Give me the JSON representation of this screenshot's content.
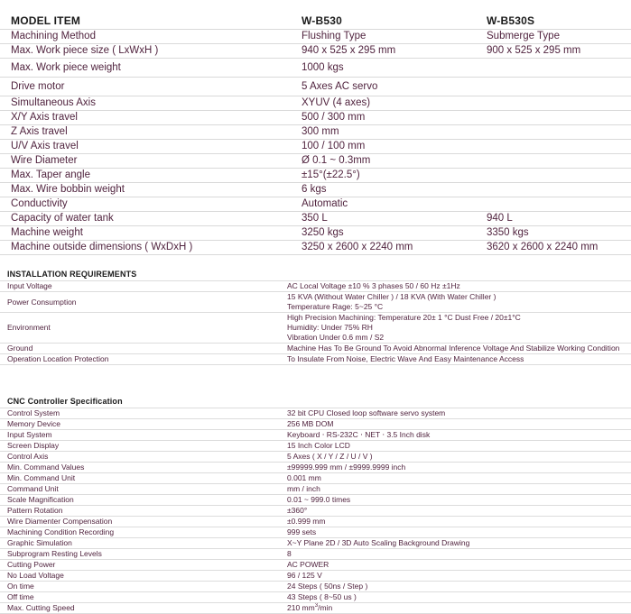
{
  "model_table": {
    "headers": [
      "MODEL ITEM",
      "W-B530",
      "W-B530S"
    ],
    "rows": [
      {
        "item": "Machining Method",
        "b530": "Flushing Type",
        "b530s": "Submerge Type"
      },
      {
        "item": "Max. Work piece size ( LxWxH )",
        "b530": "940 x 525 x 295 mm",
        "b530s": "900 x 525 x 295 mm"
      },
      {
        "item": "Max. Work piece weight",
        "b530": "1000 kgs",
        "b530s": ""
      },
      {
        "item": "Drive motor",
        "b530": "5 Axes AC servo",
        "b530s": ""
      },
      {
        "item": "Simultaneous Axis",
        "b530": "XYUV (4 axes)",
        "b530s": ""
      },
      {
        "item": "X/Y Axis travel",
        "b530": "500 / 300 mm",
        "b530s": ""
      },
      {
        "item": "Z Axis travel",
        "b530": "300 mm",
        "b530s": ""
      },
      {
        "item": "U/V Axis travel",
        "b530": "100 / 100 mm",
        "b530s": ""
      },
      {
        "item": "Wire Diameter",
        "b530": "Ø 0.1 ~ 0.3mm",
        "b530s": ""
      },
      {
        "item": "Max. Taper angle",
        "b530": "±15°(±22.5°)",
        "b530s": ""
      },
      {
        "item": "Max. Wire bobbin weight",
        "b530": "6 kgs",
        "b530s": ""
      },
      {
        "item": "Conductivity",
        "b530": "Automatic",
        "b530s": ""
      },
      {
        "item": "Capacity of water tank",
        "b530": "350 L",
        "b530s": "940 L"
      },
      {
        "item": "Machine weight",
        "b530": "3250 kgs",
        "b530s": "3350 kgs"
      },
      {
        "item": "Machine outside dimensions ( WxDxH )",
        "b530": "3250 x 2600 x 2240 mm",
        "b530s": "3620 x 2600 x 2240 mm"
      }
    ]
  },
  "installation": {
    "title": "INSTALLATION REQUIREMENTS",
    "rows": [
      {
        "label": "Input Voltage",
        "lines": [
          "AC Local Voltage ±10 % 3 phases 50 / 60 Hz ±1Hz"
        ]
      },
      {
        "label": "Power Consumption",
        "lines": [
          "15 KVA (Without Water Chiller ) / 18 KVA (With Water Chiller )",
          "Temperature Rage: 5~25 °C"
        ]
      },
      {
        "label": "Environment",
        "lines": [
          "High Precision Machining: Temperature 20± 1 °C Dust Free / 20±1°C",
          "Humidity: Under 75% RH",
          "Vibration Under 0.6 mm / S2"
        ]
      },
      {
        "label": "Ground",
        "lines": [
          "Machine Has To Be Ground To Avoid Abnormal Inference Voltage And Stabilize Working Condition"
        ]
      },
      {
        "label": "Operation Location Protection",
        "lines": [
          "To Insulate From Noise, Electric Wave And Easy Maintenance Access"
        ]
      }
    ]
  },
  "cnc": {
    "title": "CNC Controller Specification",
    "rows": [
      {
        "label": "Control System",
        "value": "32 bit CPU Closed loop software servo system"
      },
      {
        "label": "Memory Device",
        "value": "256 MB DOM"
      },
      {
        "label": "Input System",
        "value": "Keyboard ‧ RS-232C ‧ NET ‧ 3.5 Inch disk"
      },
      {
        "label": "Screen Display",
        "value": "15 Inch Color LCD"
      },
      {
        "label": "Control Axis",
        "value": "5 Axes ( X / Y / Z / U / V )"
      },
      {
        "label": "Min. Command Values",
        "value": "±99999.999 mm / ±9999.9999 inch"
      },
      {
        "label": "Min. Command Unit",
        "value": "0.001 mm"
      },
      {
        "label": "Command Unit",
        "value": "mm / inch"
      },
      {
        "label": "Scale Magnification",
        "value": "0.01 ~ 999.0 times"
      },
      {
        "label": "Pattern Rotation",
        "value": "±360°"
      },
      {
        "label": "Wire Diamenter Compensation",
        "value": "±0.999 mm"
      },
      {
        "label": "Machining Condition Recording",
        "value": "999 sets"
      },
      {
        "label": "Graphic Simulation",
        "value": "X~Y Plane 2D / 3D Auto Scaling Background Drawing"
      },
      {
        "label": "Subprogram Resting Levels",
        "value": "8"
      },
      {
        "label": "Cutting Power",
        "value": "AC POWER"
      },
      {
        "label": "No Load Voltage",
        "value": "96 / 125 V"
      },
      {
        "label": "On time",
        "value": "24 Steps ( 50ns / Step )"
      },
      {
        "label": "Off time",
        "value": "43 Steps ( 8~50 us )"
      },
      {
        "label": "Max. Cutting Speed",
        "value": "210 mm<sup>3</sup>/min",
        "html": true
      }
    ]
  }
}
